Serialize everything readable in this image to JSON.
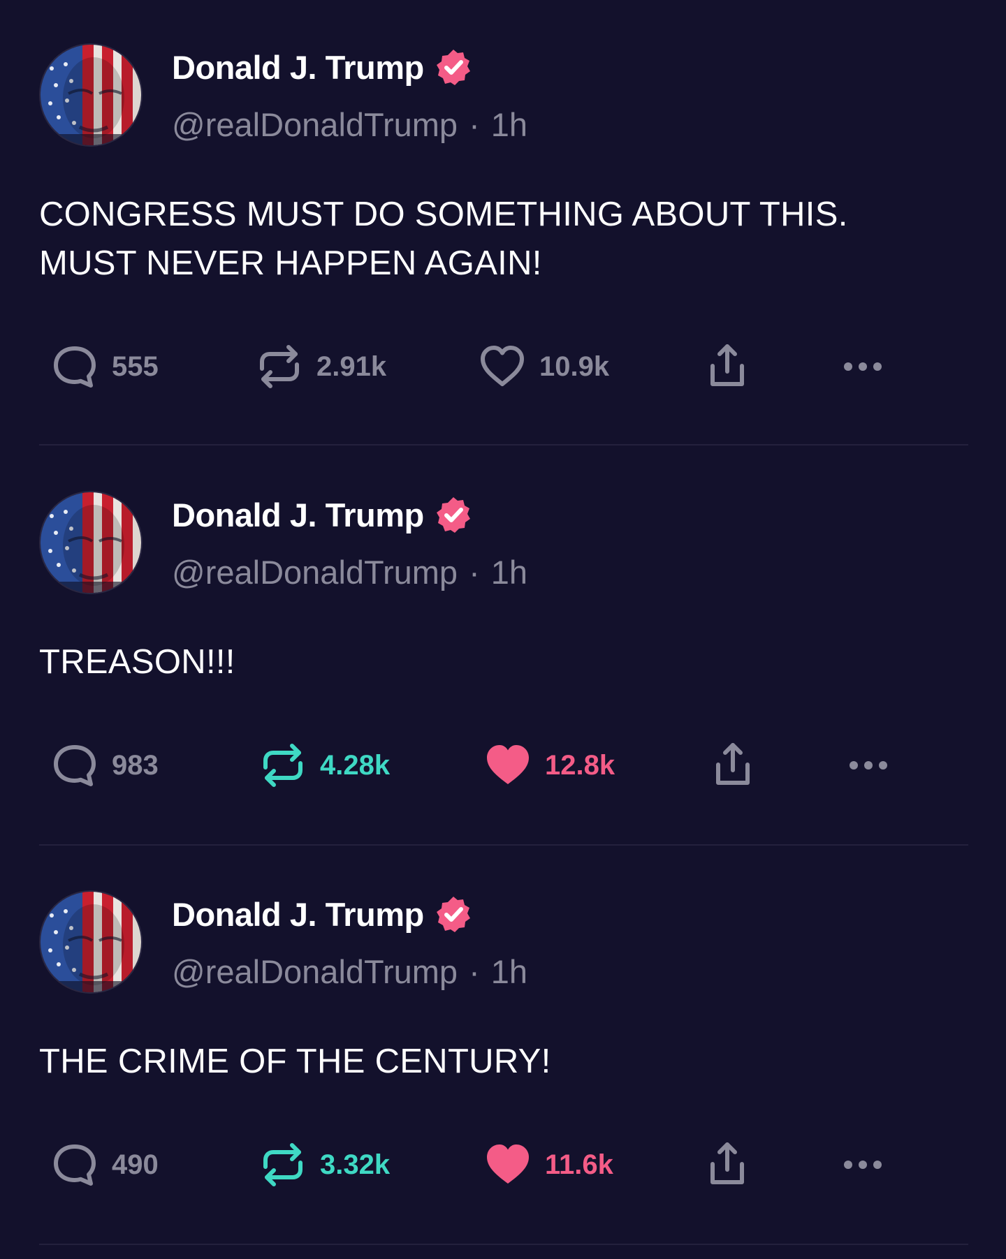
{
  "colors": {
    "background": "#13112c",
    "text_primary": "#ffffff",
    "text_secondary": "#8b8a9b",
    "verified_badge": "#f45c87",
    "retweet_active": "#3fd9c4",
    "like_active": "#f45c87",
    "divider": "#24213d"
  },
  "icons": {
    "reply": "speech-bubble-icon",
    "retweet": "retweet-arrows-icon",
    "like": "heart-icon",
    "share": "share-upload-icon",
    "more": "ellipsis-icon",
    "verified": "verified-badge-icon"
  },
  "posts": [
    {
      "author": "Donald J. Trump",
      "handle": "@realDonaldTrump",
      "separator": "·",
      "time": "1h",
      "text_lines": [
        "CONGRESS MUST DO SOMETHING ABOUT THIS.",
        "MUST NEVER HAPPEN AGAIN!"
      ],
      "replies": "555",
      "retweets": "2.91k",
      "likes": "10.9k",
      "retweeted": false,
      "liked": false
    },
    {
      "author": "Donald J. Trump",
      "handle": "@realDonaldTrump",
      "separator": "·",
      "time": "1h",
      "text_lines": [
        "TREASON!!!"
      ],
      "replies": "983",
      "retweets": "4.28k",
      "likes": "12.8k",
      "retweeted": true,
      "liked": true
    },
    {
      "author": "Donald J. Trump",
      "handle": "@realDonaldTrump",
      "separator": "·",
      "time": "1h",
      "text_lines": [
        "THE CRIME OF THE CENTURY!"
      ],
      "replies": "490",
      "retweets": "3.32k",
      "likes": "11.6k",
      "retweeted": true,
      "liked": true
    }
  ]
}
